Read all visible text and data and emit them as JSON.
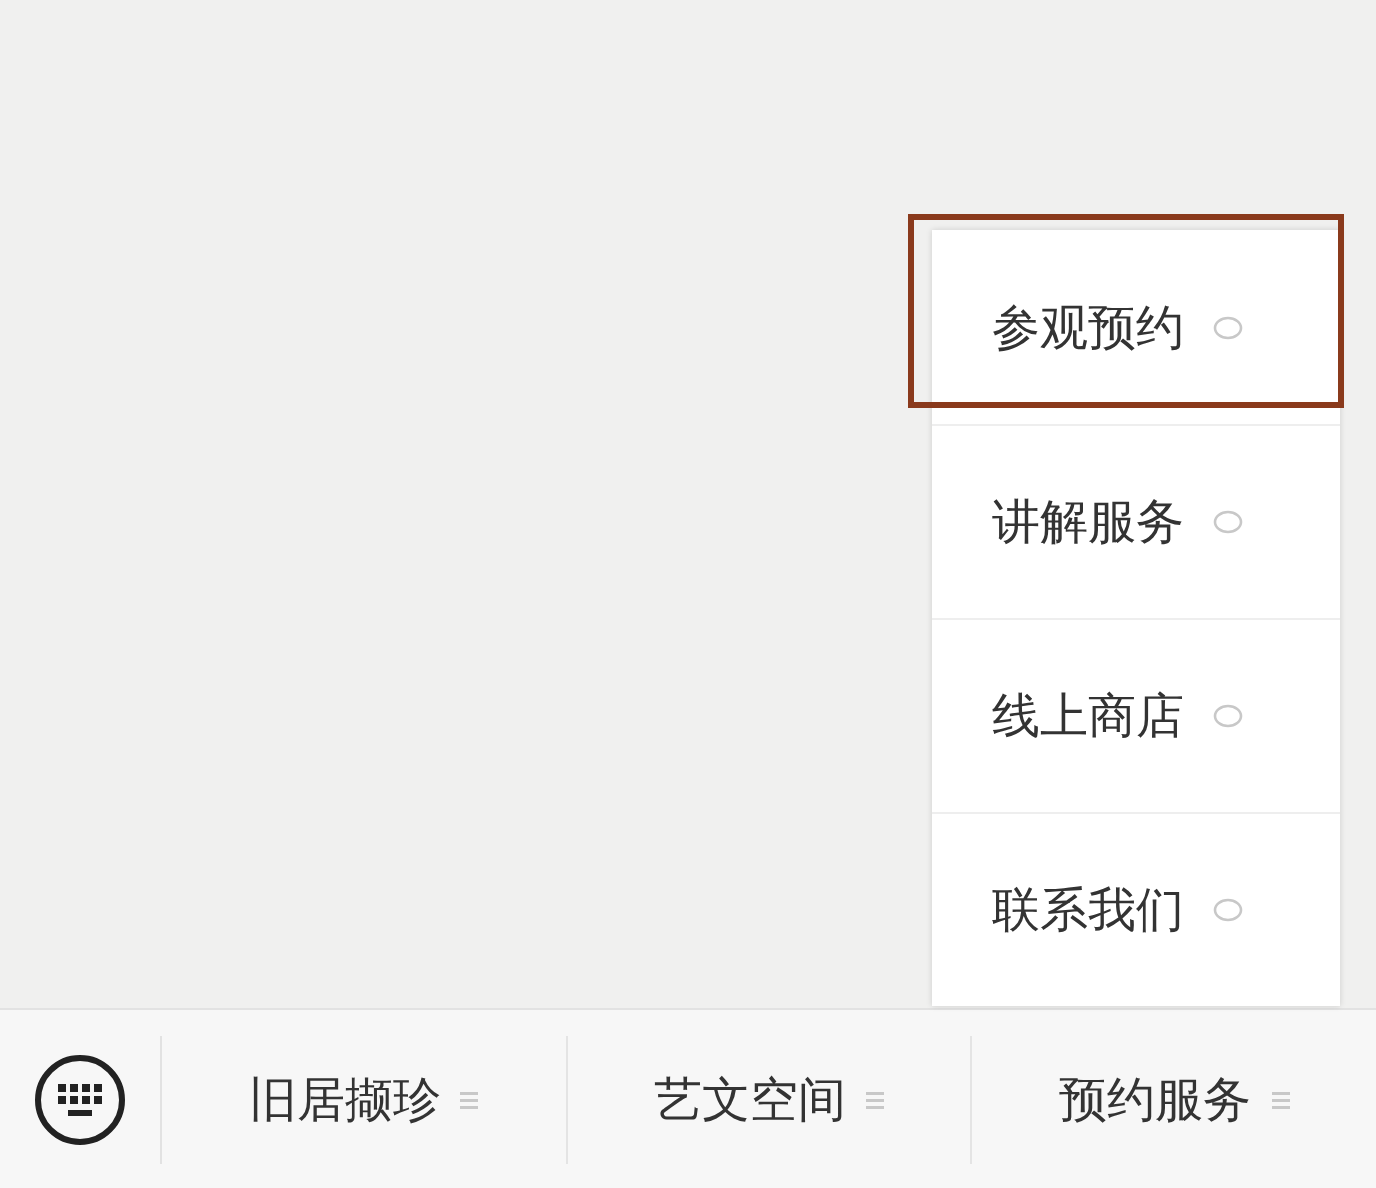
{
  "submenu": [
    {
      "label": "参观预约",
      "highlighted": true
    },
    {
      "label": "讲解服务",
      "highlighted": false
    },
    {
      "label": "线上商店",
      "highlighted": false
    },
    {
      "label": "联系我们",
      "highlighted": false
    }
  ],
  "menu_bar": [
    {
      "label": "旧居撷珍"
    },
    {
      "label": "艺文空间"
    },
    {
      "label": "预约服务"
    }
  ]
}
